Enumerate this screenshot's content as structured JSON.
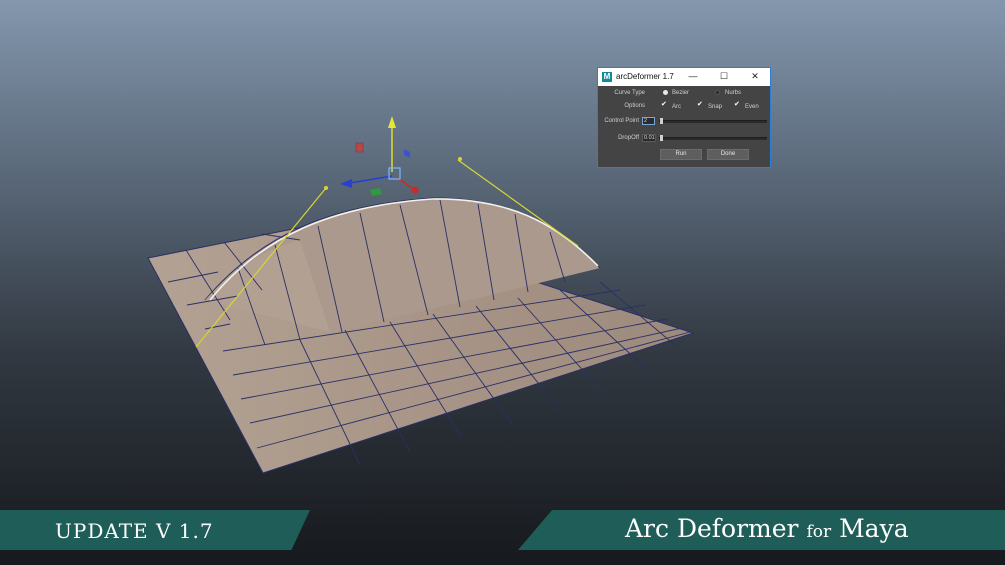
{
  "dialog": {
    "title": "arcDeformer 1.7",
    "app_icon_letter": "M",
    "window_controls": {
      "minimize": "—",
      "maximize": "☐",
      "close": "✕"
    },
    "curve_type": {
      "label": "Curve Type",
      "options": [
        "Bezier",
        "Nurbs"
      ],
      "selected": "Bezier"
    },
    "options": {
      "label": "Options",
      "checks": [
        {
          "label": "Arc",
          "checked": true
        },
        {
          "label": "Snap",
          "checked": true
        },
        {
          "label": "Even",
          "checked": true
        }
      ]
    },
    "control_point": {
      "label": "Control Point",
      "value": "2"
    },
    "dropoff": {
      "label": "DropOff",
      "value": "0.01"
    },
    "run_label": "Run",
    "done_label": "Done"
  },
  "banners": {
    "update": "UPDATE V 1.7",
    "brand_main": "Arc Deformer",
    "brand_for": "for",
    "brand_app": "Maya"
  },
  "colors": {
    "mesh_face": "#a9978b",
    "mesh_lines": "#2b2f66",
    "curve_yellow": "#d6d632",
    "banner_teal": "#1f5e58",
    "dialog_border": "#2b7dd6"
  },
  "icons": {
    "check": "✔"
  }
}
